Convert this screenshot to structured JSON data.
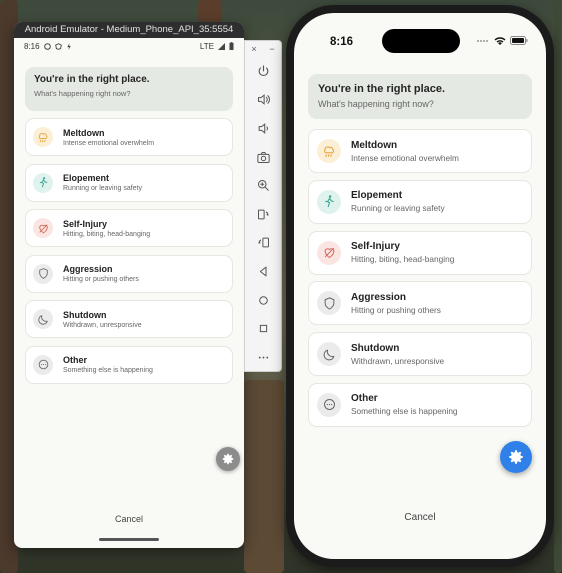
{
  "android": {
    "window_title": "Android Emulator - Medium_Phone_API_35:5554",
    "status": {
      "time": "8:16",
      "network": "LTE"
    },
    "banner": {
      "title": "You're in the right place.",
      "subtitle": "What's happening right now?"
    },
    "items": [
      {
        "title": "Meltdown",
        "subtitle": "Intense emotional overwhelm",
        "icon": "meltdown-icon",
        "icon_bg": "#fbefd6",
        "icon_color": "#e6a23c"
      },
      {
        "title": "Elopement",
        "subtitle": "Running or leaving safety",
        "icon": "running-person-icon",
        "icon_bg": "#dff2ee",
        "icon_color": "#3aa592"
      },
      {
        "title": "Self-Injury",
        "subtitle": "Hitting, biting, head-banging",
        "icon": "heart-off-icon",
        "icon_bg": "#fbe5e2",
        "icon_color": "#d0695b"
      },
      {
        "title": "Aggression",
        "subtitle": "Hitting or pushing others",
        "icon": "shield-icon",
        "icon_bg": "#ebebeb",
        "icon_color": "#666666"
      },
      {
        "title": "Shutdown",
        "subtitle": "Withdrawn, unresponsive",
        "icon": "moon-icon",
        "icon_bg": "#ebebeb",
        "icon_color": "#666666"
      },
      {
        "title": "Other",
        "subtitle": "Something else is happening",
        "icon": "more-circle-icon",
        "icon_bg": "#ebebeb",
        "icon_color": "#666666"
      }
    ],
    "fab_color": "#8c8c8c",
    "cancel_label": "Cancel"
  },
  "toolbar": {
    "close_label": "×",
    "minimize_label": "−",
    "buttons": [
      "power-icon",
      "volume-up-icon",
      "volume-down-icon",
      "camera-icon",
      "zoom-in-icon",
      "rotate-left-icon",
      "rotate-right-icon",
      "back-icon",
      "home-icon",
      "overview-icon",
      "more-icon"
    ]
  },
  "ios": {
    "status": {
      "time": "8:16"
    },
    "banner": {
      "title": "You're in the right place.",
      "subtitle": "What's happening right now?"
    },
    "items": [
      {
        "title": "Meltdown",
        "subtitle": "Intense emotional overwhelm",
        "icon": "meltdown-icon",
        "icon_bg": "#fbefd6",
        "icon_color": "#e6a23c"
      },
      {
        "title": "Elopement",
        "subtitle": "Running or leaving safety",
        "icon": "running-person-icon",
        "icon_bg": "#dff2ee",
        "icon_color": "#3aa592"
      },
      {
        "title": "Self-Injury",
        "subtitle": "Hitting, biting, head-banging",
        "icon": "heart-off-icon",
        "icon_bg": "#fbe5e2",
        "icon_color": "#d0695b"
      },
      {
        "title": "Aggression",
        "subtitle": "Hitting or pushing others",
        "icon": "shield-icon",
        "icon_bg": "#ebebeb",
        "icon_color": "#666666"
      },
      {
        "title": "Shutdown",
        "subtitle": "Withdrawn, unresponsive",
        "icon": "moon-icon",
        "icon_bg": "#ebebeb",
        "icon_color": "#666666"
      },
      {
        "title": "Other",
        "subtitle": "Something else is happening",
        "icon": "more-circle-icon",
        "icon_bg": "#ebebeb",
        "icon_color": "#666666"
      }
    ],
    "fab_color": "#2f80e9",
    "cancel_label": "Cancel"
  }
}
